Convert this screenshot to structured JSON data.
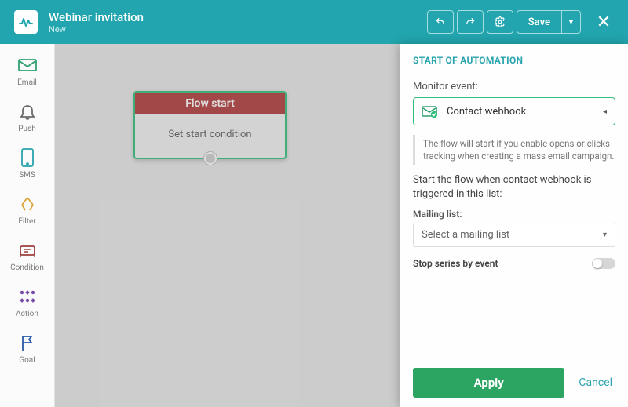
{
  "header": {
    "title": "Webinar invitation",
    "subtitle": "New",
    "save_label": "Save"
  },
  "sidebar": {
    "items": [
      {
        "label": "Email",
        "icon": "email-icon",
        "color": "#2fa06f"
      },
      {
        "label": "Push",
        "icon": "push-icon",
        "color": "#6b6b6b"
      },
      {
        "label": "SMS",
        "icon": "sms-icon",
        "color": "#2aa4ad"
      },
      {
        "label": "Filter",
        "icon": "filter-icon",
        "color": "#d9a53a"
      },
      {
        "label": "Condition",
        "icon": "condition-icon",
        "color": "#9c3f3f"
      },
      {
        "label": "Action",
        "icon": "action-icon",
        "color": "#7a4aa8"
      },
      {
        "label": "Goal",
        "icon": "goal-icon",
        "color": "#2a5aa8"
      }
    ]
  },
  "flow_card": {
    "title": "Flow start",
    "body": "Set start condition"
  },
  "panel": {
    "title": "START OF AUTOMATION",
    "monitor_label": "Monitor event:",
    "event_value": "Contact webhook",
    "hint": "The flow will start if you enable opens or clicks tracking when creating a mass email campaign.",
    "desc": "Start the flow when contact webhook is triggered in this list:",
    "mailing_label": "Mailing list:",
    "mailing_placeholder": "Select a mailing list",
    "stop_label": "Stop series by event",
    "apply_label": "Apply",
    "cancel_label": "Cancel"
  }
}
